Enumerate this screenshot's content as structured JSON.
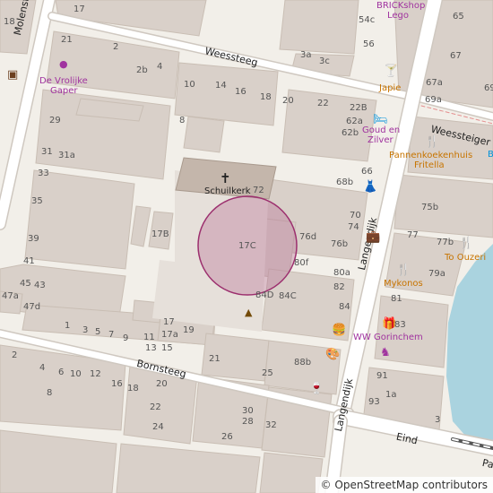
{
  "streets": {
    "molenstraat": "Molenstraat",
    "weessteeg": "Weessteeg",
    "weessteiger": "Weessteiger",
    "langendijk": "Langendijk",
    "langendijk_lower": "Langendijk",
    "bornsteeg": "Bornsteeg",
    "eind": "Eind",
    "pa": "Pa"
  },
  "pois": {
    "schuilkerk": "Schuilkerk",
    "vrolijke_1": "De Vrolijke",
    "vrolijke_2": "Gaper",
    "brickshop_1": "BRICKshop",
    "brickshop_2": "Lego",
    "japie": "Japie",
    "goud_1": "Goud en",
    "goud_2": "Zilver",
    "pannenkoek_1": "Pannenkoekenhuis",
    "pannenkoek_2": "Fritella",
    "to_ouzeri": "To Ouzeri",
    "mykonos": "Mykonos",
    "ww_gorinchem": "WW Gorinchem",
    "b_partial": "B"
  },
  "house_numbers": {
    "n18": "18",
    "n17": "17",
    "n21": "21",
    "n2": "2",
    "n2b": "2b",
    "n4": "4",
    "n29": "29",
    "n31": "31",
    "n31a": "31a",
    "n33": "33",
    "n35": "35",
    "n39": "39",
    "n41": "41",
    "n45": "45",
    "n43": "43",
    "n47a": "47a",
    "n47d": "47d",
    "n10": "10",
    "n14": "14",
    "n16": "16",
    "n18b": "18",
    "n20": "20",
    "n22": "22",
    "n8": "8",
    "n3a": "3a",
    "n3c": "3c",
    "n54c": "54c",
    "n56": "56",
    "n22b": "22B",
    "n62a": "62a",
    "n62b": "62b",
    "n66": "66",
    "n68b": "68b",
    "n72": "72",
    "n70": "70",
    "n74": "74",
    "n76d": "76d",
    "n76b": "76b",
    "n17b": "17B",
    "n17c": "17C",
    "n80f": "80f",
    "n80a": "80a",
    "n82": "82",
    "n84": "84",
    "n84d": "84D",
    "n84c": "84C",
    "n88b": "88b",
    "n65": "65",
    "n67": "67",
    "n69": "69",
    "n67a": "67a",
    "n69a": "69a",
    "n75b": "75b",
    "n77": "77",
    "n77b": "77b",
    "n79a": "79a",
    "n81": "81",
    "n83": "83",
    "n91": "91",
    "n1a": "1a",
    "n93": "93",
    "n3": "3",
    "n1": "1",
    "n3s": "3",
    "n5": "5",
    "n7": "7",
    "n9": "9",
    "n11": "11",
    "n13": "13",
    "n15": "15",
    "n17a": "17a",
    "n17x": "17",
    "n19": "19",
    "n21b": "21",
    "n2s": "2",
    "n4s": "4",
    "n6": "6",
    "n8s": "8",
    "n10s": "10",
    "n12": "12",
    "n16s": "16",
    "n18s": "18",
    "n20s": "20",
    "n22s": "22",
    "n24": "24",
    "n26": "26",
    "n25": "25",
    "n28": "28",
    "n30": "30",
    "n32": "32"
  },
  "attribution": {
    "symbol": "©",
    "text": "OpenStreetMap contributors"
  },
  "icons": {
    "church": "church-cross-icon",
    "museum": "museum-icon",
    "bar": "cocktail-bar-icon",
    "bed": "hotel-bed-icon",
    "restaurant": "restaurant-fork-knife-icon",
    "clothes": "clothes-shop-icon",
    "luggage": "luggage-shop-icon",
    "toy": "toy-shop-icon",
    "fast_food": "fast-food-icon",
    "art": "art-palette-icon",
    "wine": "wine-shop-icon",
    "marker": "location-circle-marker"
  },
  "colors": {
    "background": "#f2efe9",
    "building": "#d9d0c9",
    "church_building": "#c4b6ab",
    "road": "#ffffff",
    "water": "#aad3df",
    "marker_fill": "#b4668f",
    "poi_text": "#a0339f",
    "food_text": "#c77400"
  }
}
